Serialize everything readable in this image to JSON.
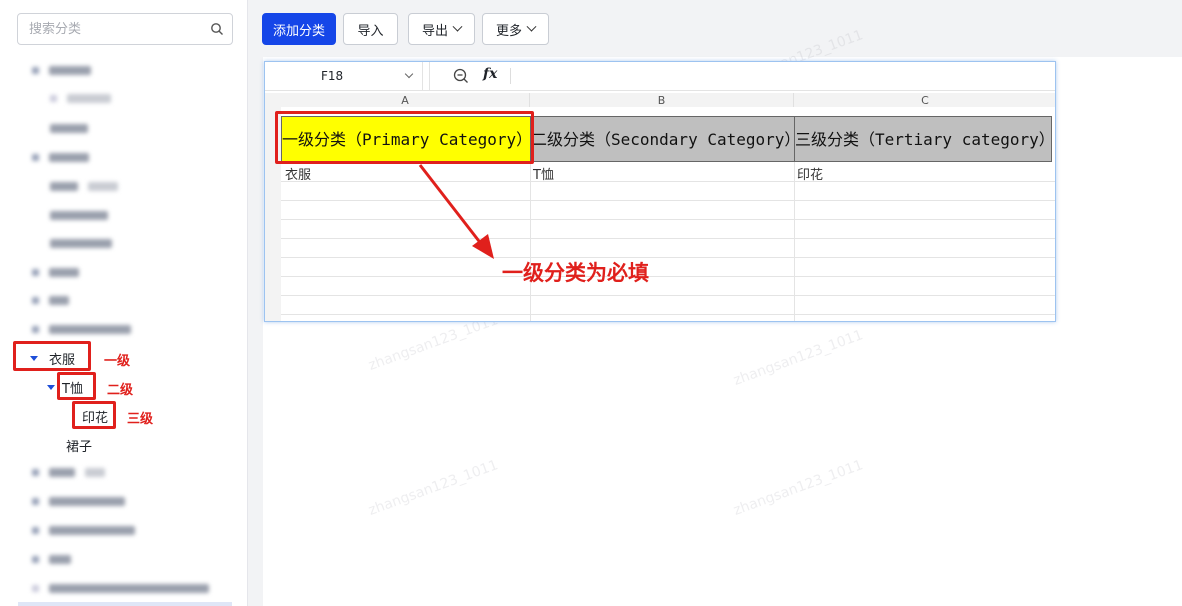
{
  "sidebar": {
    "search_placeholder": "搜索分类",
    "tree": {
      "level1": "衣服",
      "level2": "T恤",
      "level3": "印花",
      "sibling": "裙子"
    },
    "annotations": {
      "level1": "一级",
      "level2": "二级",
      "level3": "三级"
    }
  },
  "toolbar": {
    "add_label": "添加分类",
    "import_label": "导入",
    "export_label": "导出",
    "more_label": "更多"
  },
  "spreadsheet": {
    "name_box": "F18",
    "fx_label": "fx",
    "columns": [
      "A",
      "B",
      "C"
    ],
    "headers": {
      "a": "一级分类（Primary Category）",
      "b": "二级分类（Secondary Category）",
      "c": "三级分类（Tertiary category）"
    },
    "row2": {
      "a": "衣服",
      "b": "T恤",
      "c": "印花"
    },
    "colors": {
      "primary_header_bg": "#ffff00",
      "header_bg": "#bfbfbf"
    }
  },
  "annotation_text": "一级分类为必填",
  "colors": {
    "accent": "#1546e8",
    "highlight_red": "#e0201c"
  },
  "watermark": "zhangsan123_1011"
}
